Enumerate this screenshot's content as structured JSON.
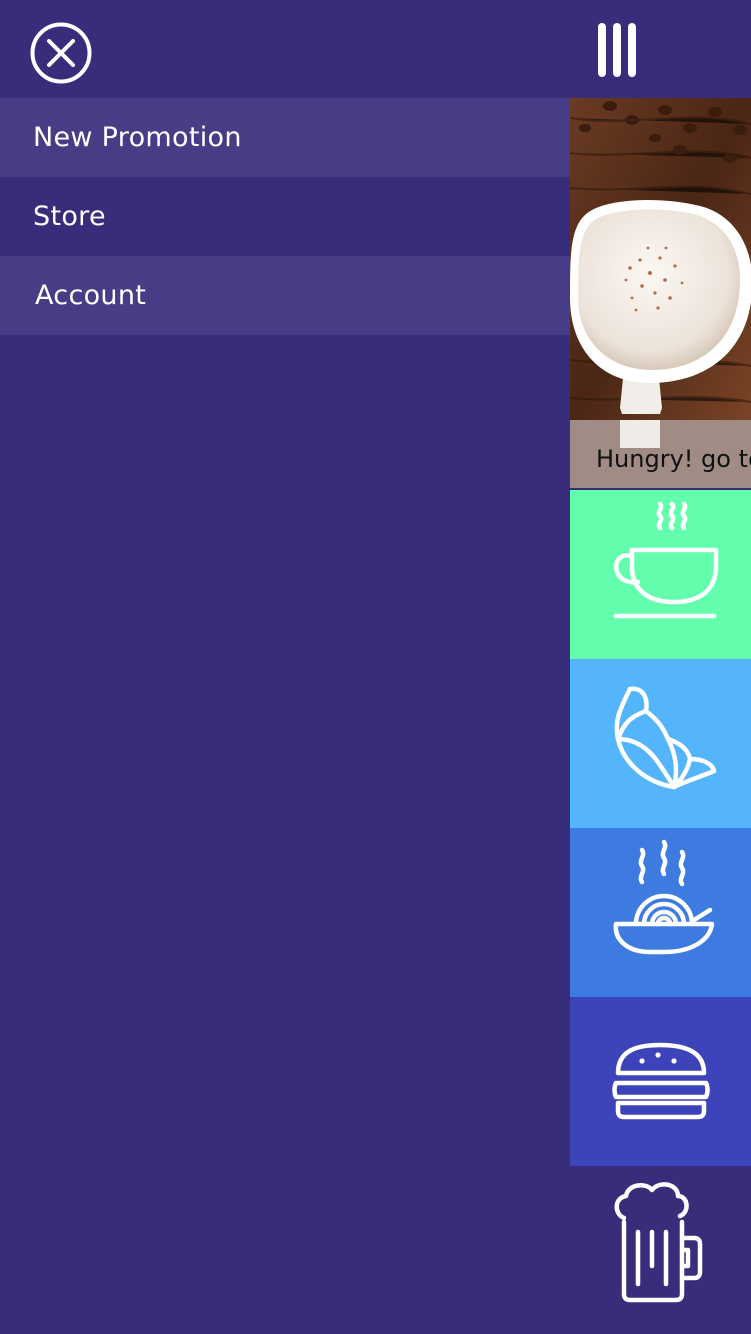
{
  "menu": {
    "items": [
      {
        "label": "New Promotion",
        "highlighted": true
      },
      {
        "label": "Store",
        "highlighted": false
      },
      {
        "label": "Account",
        "highlighted": true
      }
    ]
  },
  "promo": {
    "caption": "Hungry! go to"
  },
  "categories": [
    {
      "icon": "coffee-cup-icon",
      "color": "#63fdae"
    },
    {
      "icon": "croissant-icon",
      "color": "#54b4fc"
    },
    {
      "icon": "noodle-bowl-icon",
      "color": "#3e7be0"
    },
    {
      "icon": "burger-icon",
      "color": "#3d43b8"
    },
    {
      "icon": "beer-mug-icon",
      "color": "#372d7b"
    }
  ],
  "colors": {
    "background": "#372d7b",
    "menu_highlight": "#473d87",
    "icon": "#ffffff"
  }
}
